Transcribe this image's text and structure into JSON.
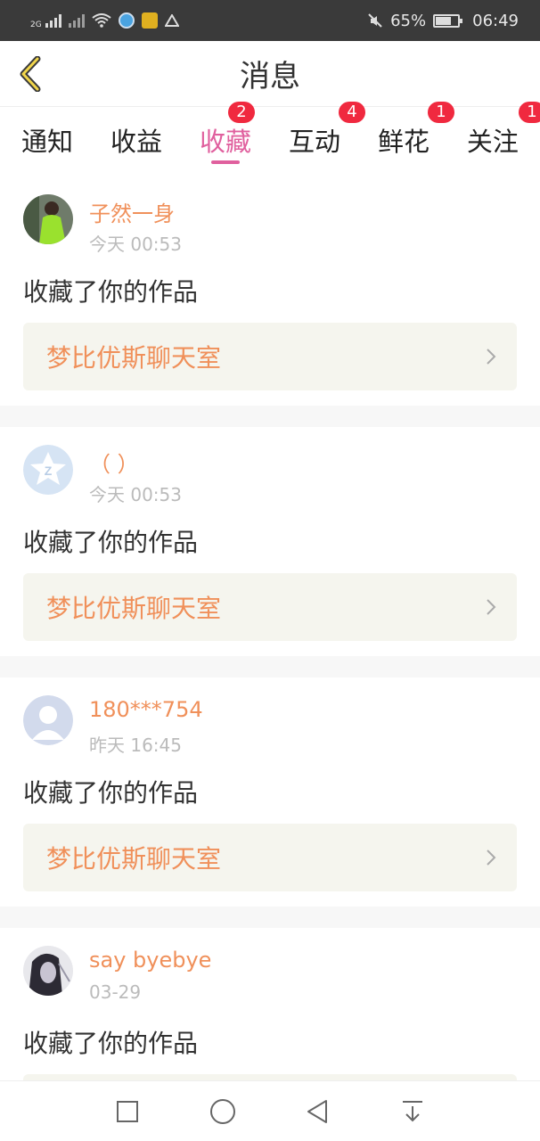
{
  "status_bar": {
    "net_label": "2G",
    "battery_pct": "65%",
    "time": "06:49"
  },
  "header": {
    "title": "消息"
  },
  "tabs": [
    {
      "label": "通知",
      "badge": ""
    },
    {
      "label": "收益",
      "badge": ""
    },
    {
      "label": "收藏",
      "badge": "2",
      "active": true
    },
    {
      "label": "互动",
      "badge": "4"
    },
    {
      "label": "鲜花",
      "badge": "1"
    },
    {
      "label": "关注",
      "badge": "1"
    }
  ],
  "items": [
    {
      "name": "子然一身",
      "time": "今天 00:53",
      "action": "收藏了你的作品",
      "work": "梦比优斯聊天室",
      "avatar": "photo-green-avatar"
    },
    {
      "name": "（ ）",
      "time": "今天 00:53",
      "action": "收藏了你的作品",
      "work": "梦比优斯聊天室",
      "avatar": "qq-star-avatar"
    },
    {
      "name": "180***754",
      "time": "昨天 16:45",
      "action": "收藏了你的作品",
      "work": "梦比优斯聊天室",
      "avatar": "default-user-avatar"
    },
    {
      "name": "say byebye",
      "time": "03-29",
      "action": "收藏了你的作品",
      "work": "",
      "avatar": "photo-dark-avatar"
    }
  ],
  "colors": {
    "accent": "#e0609e",
    "username": "#f0905a",
    "badge": "#f0293f"
  }
}
